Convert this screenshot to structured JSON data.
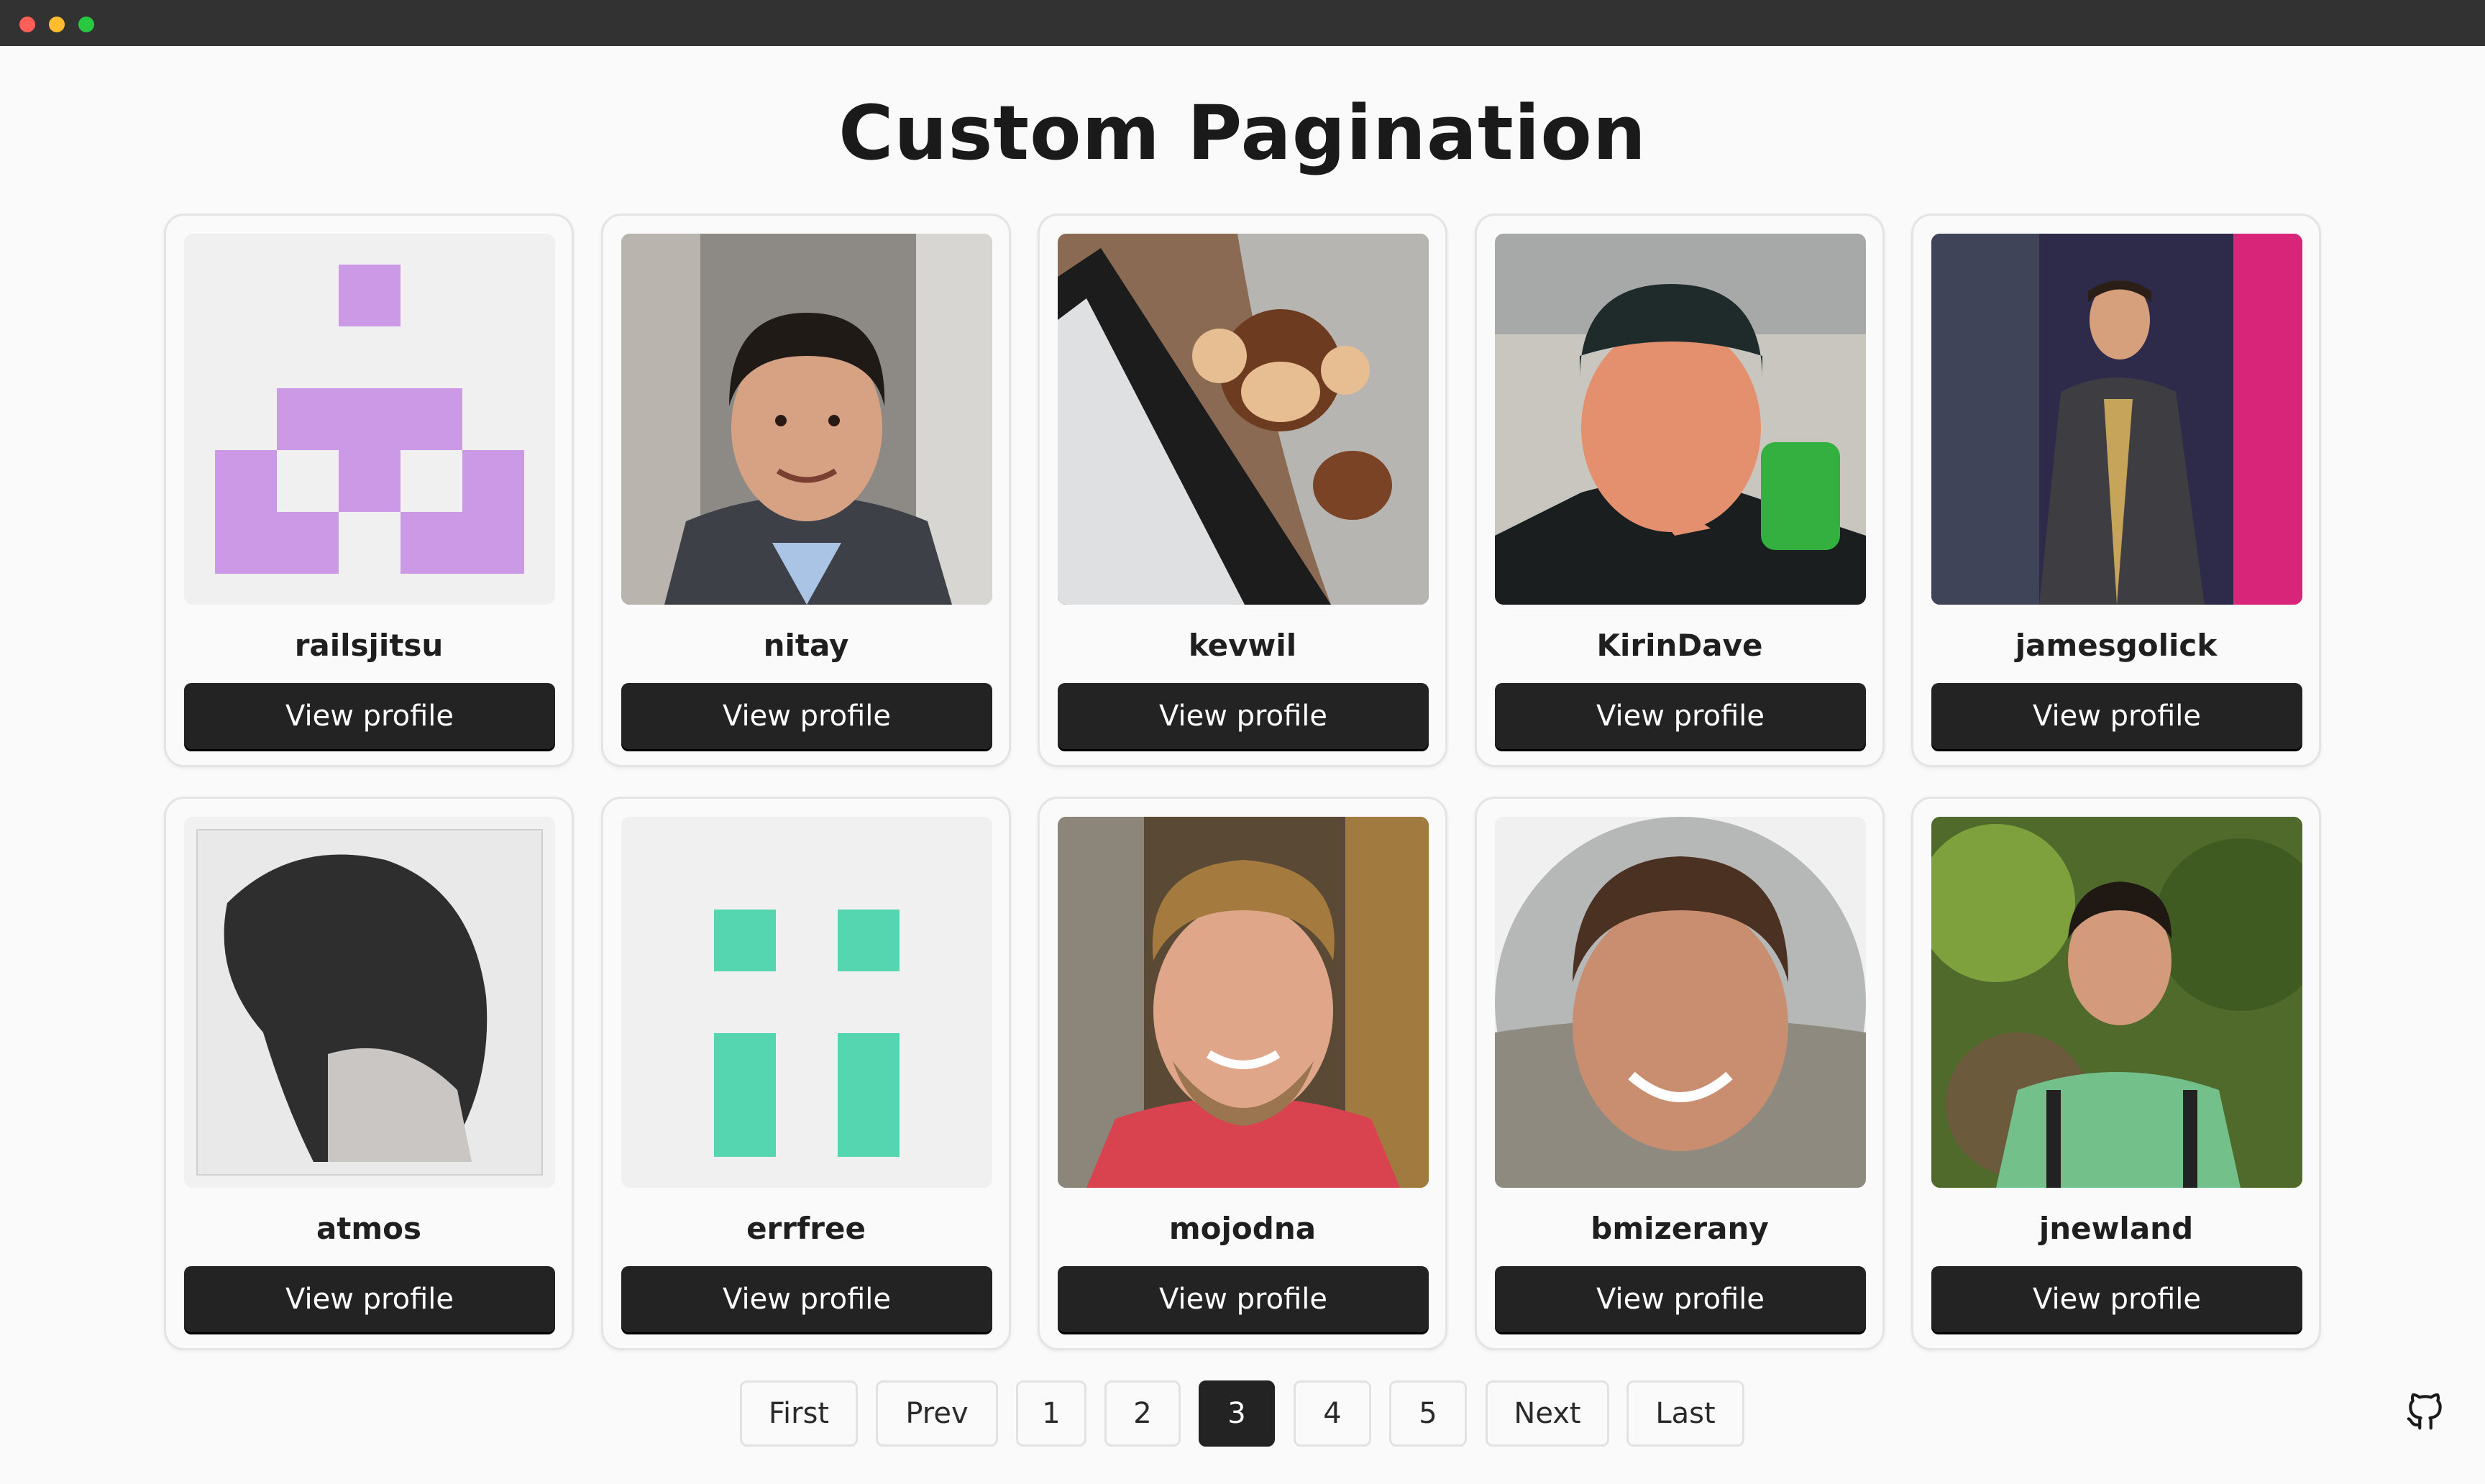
{
  "page": {
    "title": "Custom Pagination"
  },
  "colors": {
    "button_bg": "#232323",
    "button_text": "#ffffff",
    "identicon_purple": "#cc99e6",
    "identicon_teal": "#55d6b0",
    "page_bg": "#fafafa"
  },
  "users": [
    {
      "username": "railsjitsu",
      "button": "View profile",
      "avatar": "identicon-purple"
    },
    {
      "username": "nitay",
      "button": "View profile",
      "avatar": "photo"
    },
    {
      "username": "kevwil",
      "button": "View profile",
      "avatar": "photo"
    },
    {
      "username": "KirinDave",
      "button": "View profile",
      "avatar": "photo"
    },
    {
      "username": "jamesgolick",
      "button": "View profile",
      "avatar": "photo"
    },
    {
      "username": "atmos",
      "button": "View profile",
      "avatar": "photo"
    },
    {
      "username": "errfree",
      "button": "View profile",
      "avatar": "identicon-teal"
    },
    {
      "username": "mojodna",
      "button": "View profile",
      "avatar": "photo"
    },
    {
      "username": "bmizerany",
      "button": "View profile",
      "avatar": "photo"
    },
    {
      "username": "jnewland",
      "button": "View profile",
      "avatar": "photo"
    }
  ],
  "pagination": {
    "first": "First",
    "prev": "Prev",
    "pages": [
      "1",
      "2",
      "3",
      "4",
      "5"
    ],
    "current": "3",
    "next": "Next",
    "last": "Last"
  },
  "footer": {
    "icon": "github-icon"
  }
}
